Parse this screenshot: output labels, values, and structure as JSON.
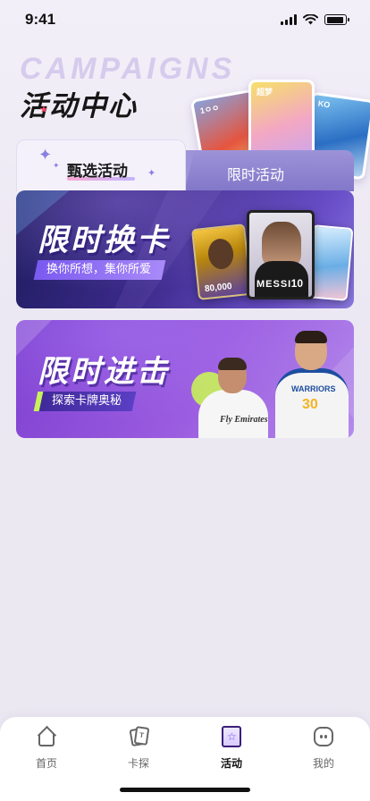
{
  "status_bar": {
    "time": "9:41"
  },
  "header": {
    "title_en": "CAMPAIGNS",
    "title_cn": "活动中心",
    "card_labels": [
      "1ㅇㅇ",
      "超梦",
      "KO"
    ]
  },
  "tabs": [
    {
      "label": "甄选活动",
      "active": true
    },
    {
      "label": "限时活动",
      "active": false
    }
  ],
  "banners": [
    {
      "title": "限时换卡",
      "subtitle": "换你所想，集你所爱",
      "card_texts": {
        "messi_name": "MESSI",
        "messi_number": "10",
        "lebron_number": "80,000"
      }
    },
    {
      "title": "限时进击",
      "subtitle": "探索卡牌奥秘",
      "player_texts": {
        "ronaldo_sponsor": "Fly Emirates",
        "curry_team": "WARRIORS",
        "curry_number": "30"
      }
    }
  ],
  "bottom_nav": [
    {
      "label": "首页",
      "icon": "home-icon",
      "active": false
    },
    {
      "label": "卡探",
      "icon": "cards-icon",
      "active": false
    },
    {
      "label": "活动",
      "icon": "star-badge-icon",
      "active": true
    },
    {
      "label": "我的",
      "icon": "smiley-face-icon",
      "active": false
    }
  ],
  "colors": {
    "accent": "#7a3fe0",
    "tab_inactive": "#8f85d0",
    "banner1_bg": "#3b2a8a",
    "banner2_bg": "#9b5ce0"
  }
}
